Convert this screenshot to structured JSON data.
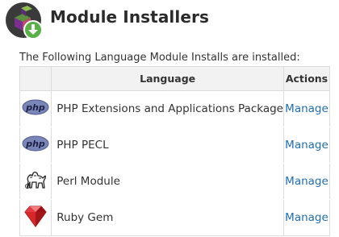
{
  "page": {
    "title": "Module Installers",
    "intro": "The Following Language Module Installs are installed:"
  },
  "table": {
    "headers": {
      "icon": "",
      "language": "Language",
      "actions": "Actions"
    },
    "rows": [
      {
        "icon": "php-icon",
        "name": "PHP Extensions and Applications Package",
        "action": "Manage"
      },
      {
        "icon": "php-icon",
        "name": "PHP PECL",
        "action": "Manage"
      },
      {
        "icon": "perl-camel-icon",
        "name": "Perl Module",
        "action": "Manage"
      },
      {
        "icon": "ruby-gem-icon",
        "name": "Ruby Gem",
        "action": "Manage"
      }
    ]
  },
  "colors": {
    "link": "#1f6fb2",
    "header_bg": "#f2f2f2",
    "border": "#dcdcdc"
  }
}
